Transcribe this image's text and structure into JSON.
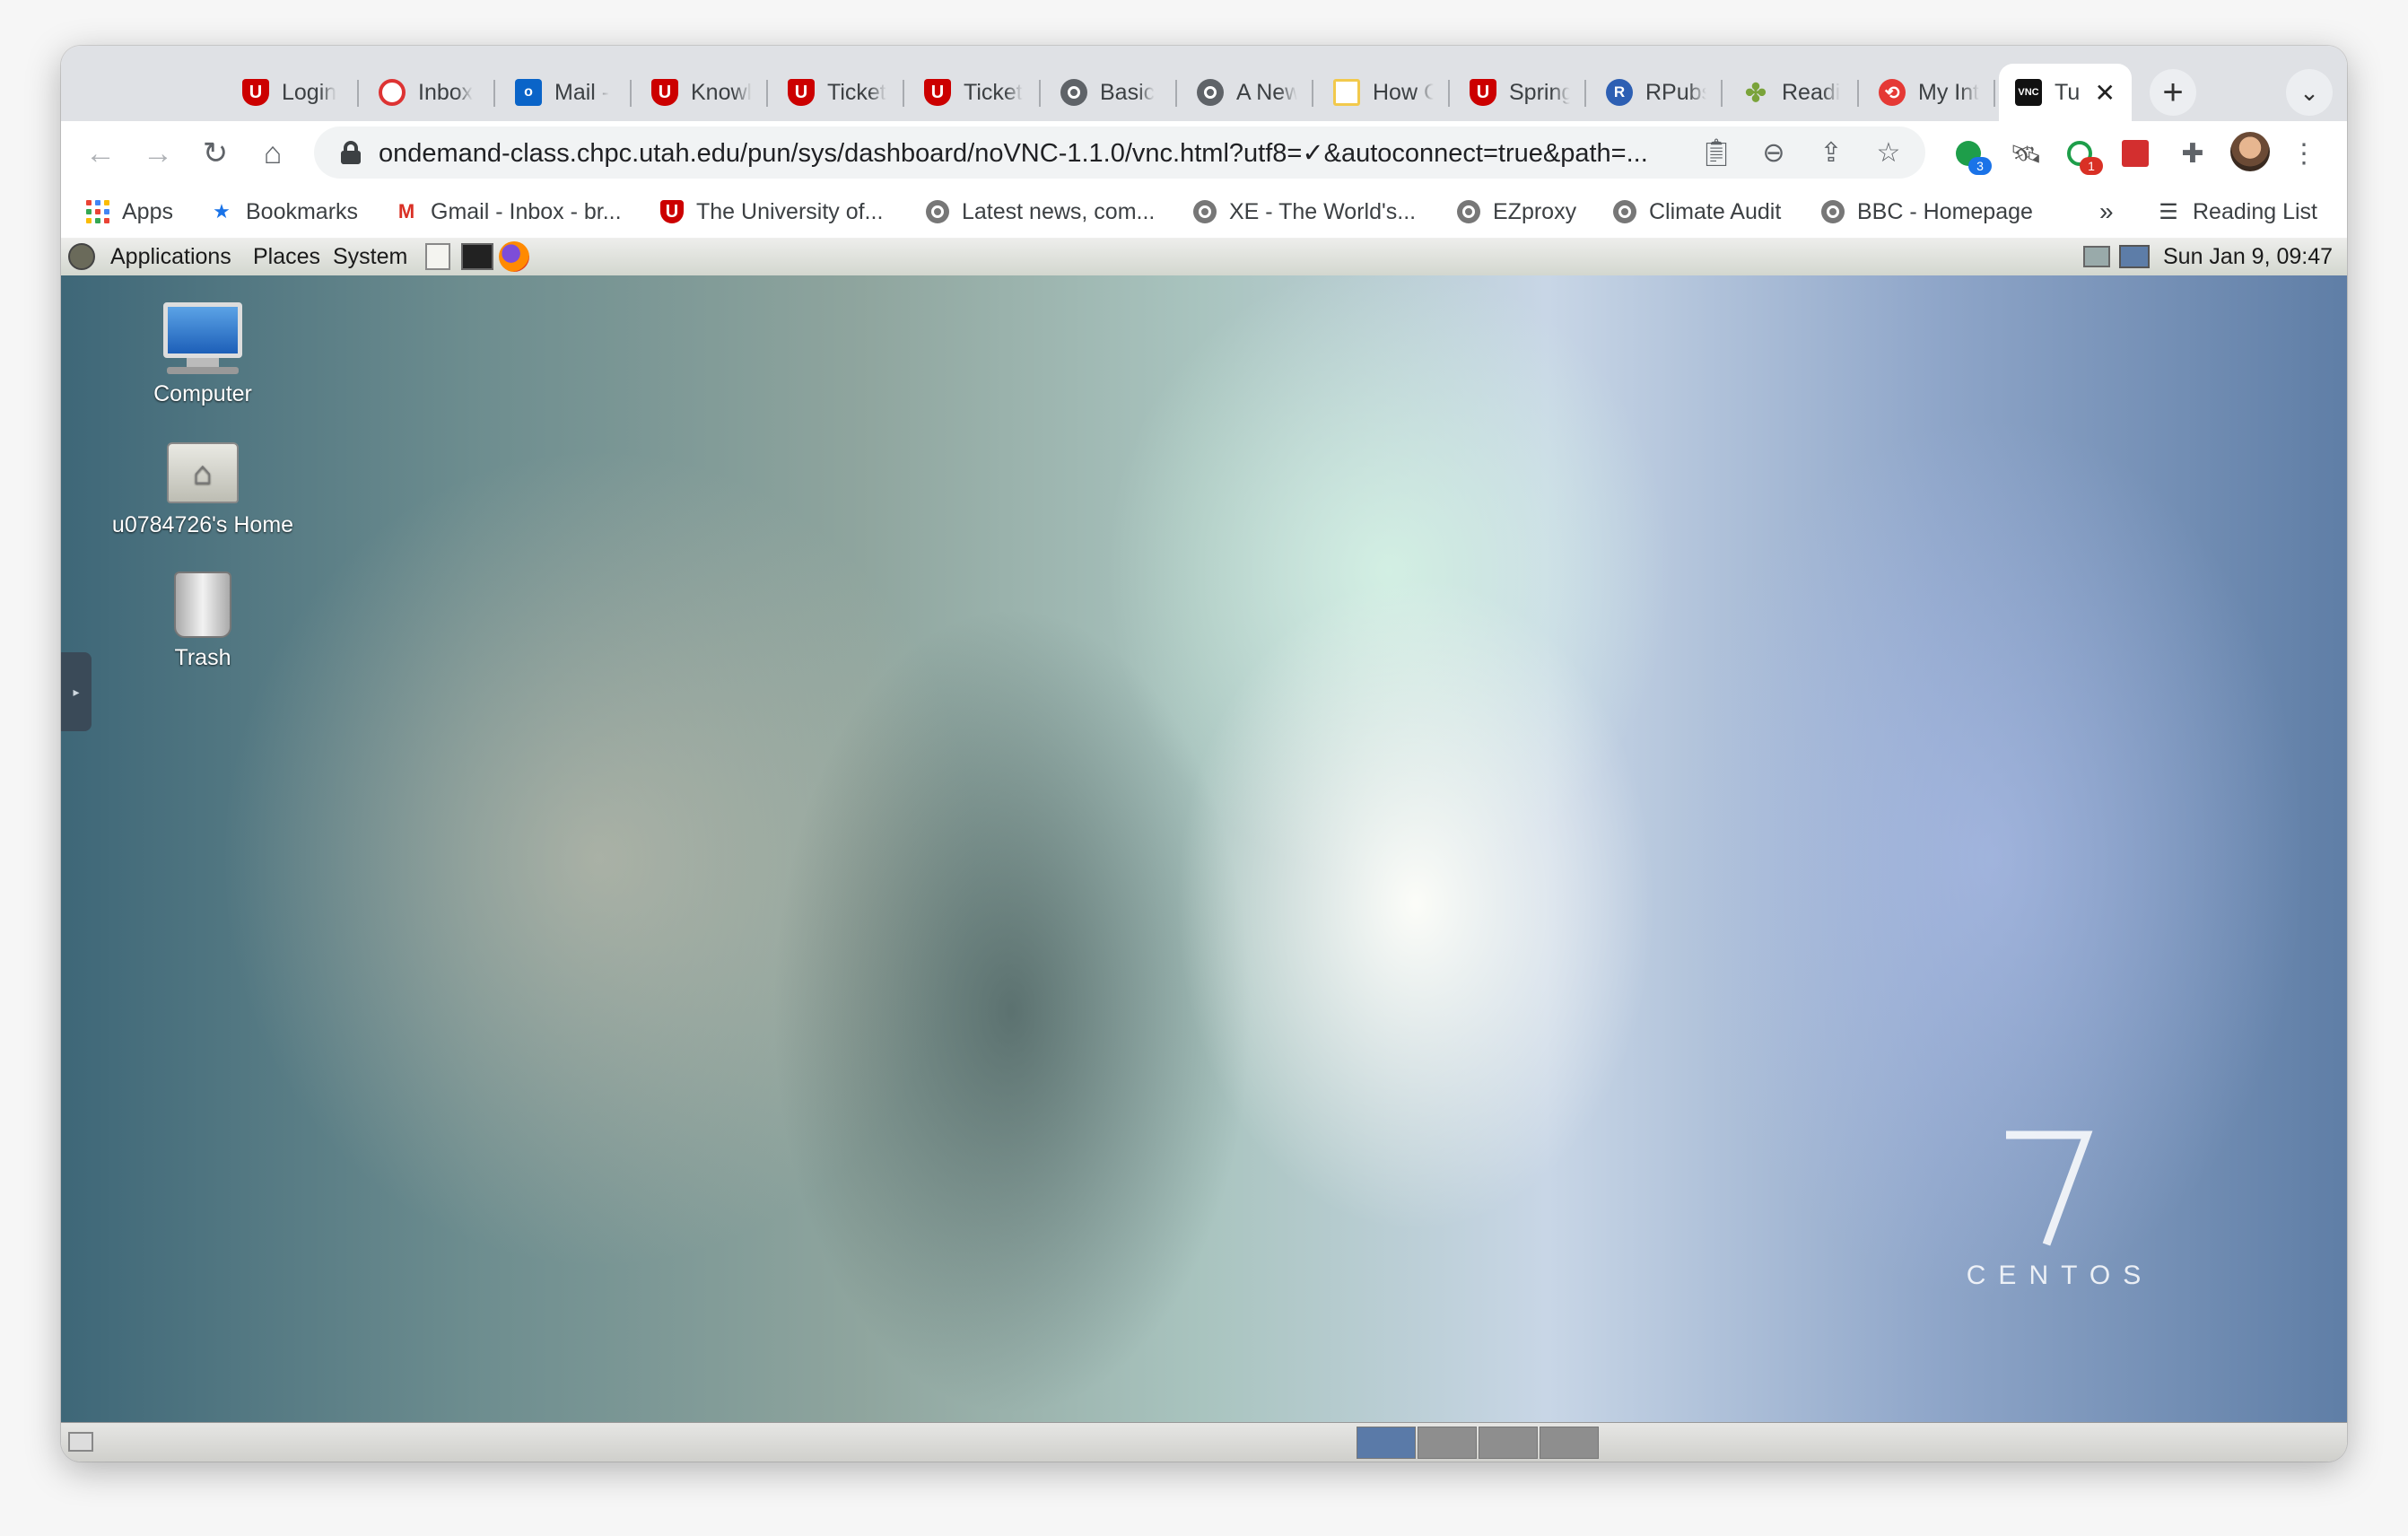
{
  "browser": {
    "tabs": [
      {
        "title": "Login",
        "icon": "university-u-icon",
        "active": false
      },
      {
        "title": "Inbox",
        "icon": "inbox-app-icon",
        "active": false
      },
      {
        "title": "Mail -",
        "icon": "outlook-icon",
        "active": false
      },
      {
        "title": "Knowl",
        "icon": "university-u-icon",
        "active": false
      },
      {
        "title": "Ticket",
        "icon": "university-u-icon",
        "active": false
      },
      {
        "title": "Ticket",
        "icon": "university-u-icon",
        "active": false
      },
      {
        "title": "Basic",
        "icon": "globe-icon",
        "active": false
      },
      {
        "title": "A New",
        "icon": "globe-icon",
        "active": false
      },
      {
        "title": "How C",
        "icon": "note-icon",
        "active": false
      },
      {
        "title": "Spring",
        "icon": "university-u-icon",
        "active": false
      },
      {
        "title": "RPubs",
        "icon": "r-icon",
        "active": false
      },
      {
        "title": "Readi",
        "icon": "reading-icon",
        "active": false
      },
      {
        "title": "My Int",
        "icon": "my-int-icon",
        "active": false
      },
      {
        "title": "Tu",
        "icon": "vnc-icon",
        "active": true
      }
    ],
    "new_tab": "+",
    "tab_close": "✕",
    "address_bar": {
      "url": "ondemand-class.chpc.utah.edu/pun/sys/dashboard/noVNC-1.1.0/vnc.html?utf8=✓&autoconnect=true&path=..."
    },
    "extensions": {
      "badge_1": "3",
      "badge_2": "1"
    },
    "bookmarks": [
      {
        "label": "Apps",
        "icon": "apps-grid-icon"
      },
      {
        "label": "Bookmarks",
        "icon": "star-icon"
      },
      {
        "label": "Gmail - Inbox - br...",
        "icon": "gmail-icon"
      },
      {
        "label": "The University of...",
        "icon": "university-u-icon"
      },
      {
        "label": "Latest news, com...",
        "icon": "globe-icon"
      },
      {
        "label": "XE - The World's...",
        "icon": "globe-icon"
      },
      {
        "label": "EZproxy",
        "icon": "globe-icon"
      },
      {
        "label": "Climate Audit",
        "icon": "globe-icon"
      },
      {
        "label": "BBC - Homepage",
        "icon": "globe-icon"
      }
    ],
    "bookmarks_overflow": "»",
    "reading_list": "Reading List"
  },
  "remote_desktop": {
    "menus": [
      "Applications",
      "Places",
      "System"
    ],
    "clock": "Sun Jan  9, 09:47",
    "desktop_icons": [
      {
        "label": "Computer"
      },
      {
        "label": "u0784726's Home"
      },
      {
        "label": "Trash"
      }
    ],
    "wallpaper": {
      "version": "7",
      "brand": "CENTOS"
    },
    "workspaces": {
      "count": 4,
      "active_index": 0
    }
  },
  "colors": {
    "tab_strip": "#dfe1e5",
    "university_red": "#cc0000",
    "gnome_panel": "#d3d7cf",
    "workspace_active": "#5a7aa8"
  }
}
